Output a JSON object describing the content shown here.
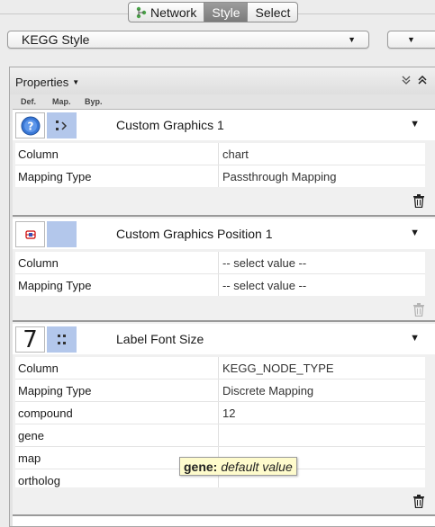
{
  "tabs": [
    {
      "label": "Network",
      "icon": "network-icon",
      "active": false
    },
    {
      "label": "Style",
      "active": true
    },
    {
      "label": "Select",
      "active": false
    }
  ],
  "style_selector": {
    "value": "KEGG Style"
  },
  "properties_panel": {
    "title": "Properties",
    "column_headers": {
      "def": "Def.",
      "map": "Map.",
      "byp": "Byp."
    },
    "sections": [
      {
        "title": "Custom Graphics 1",
        "def_icon": "help-icon",
        "map_icon": "passthrough-mapping-icon",
        "rows": [
          {
            "key": "Column",
            "value": "chart"
          },
          {
            "key": "Mapping Type",
            "value": "Passthrough Mapping"
          }
        ],
        "trash_enabled": true
      },
      {
        "title": "Custom Graphics Position 1",
        "def_icon": "position-icon",
        "map_icon": "",
        "rows": [
          {
            "key": "Column",
            "value": "-- select value --"
          },
          {
            "key": "Mapping Type",
            "value": "-- select value --"
          }
        ],
        "trash_enabled": false
      },
      {
        "title": "Label Font Size",
        "def_value": "7",
        "map_icon": "discrete-mapping-icon",
        "rows": [
          {
            "key": "Column",
            "value": "KEGG_NODE_TYPE"
          },
          {
            "key": "Mapping Type",
            "value": "Discrete Mapping"
          },
          {
            "key": "compound",
            "value": "12"
          },
          {
            "key": "gene",
            "value": ""
          },
          {
            "key": "map",
            "value": ""
          },
          {
            "key": "ortholog",
            "value": ""
          }
        ],
        "trash_enabled": true
      }
    ]
  },
  "tooltip": {
    "key": "gene:",
    "value": "default value"
  }
}
